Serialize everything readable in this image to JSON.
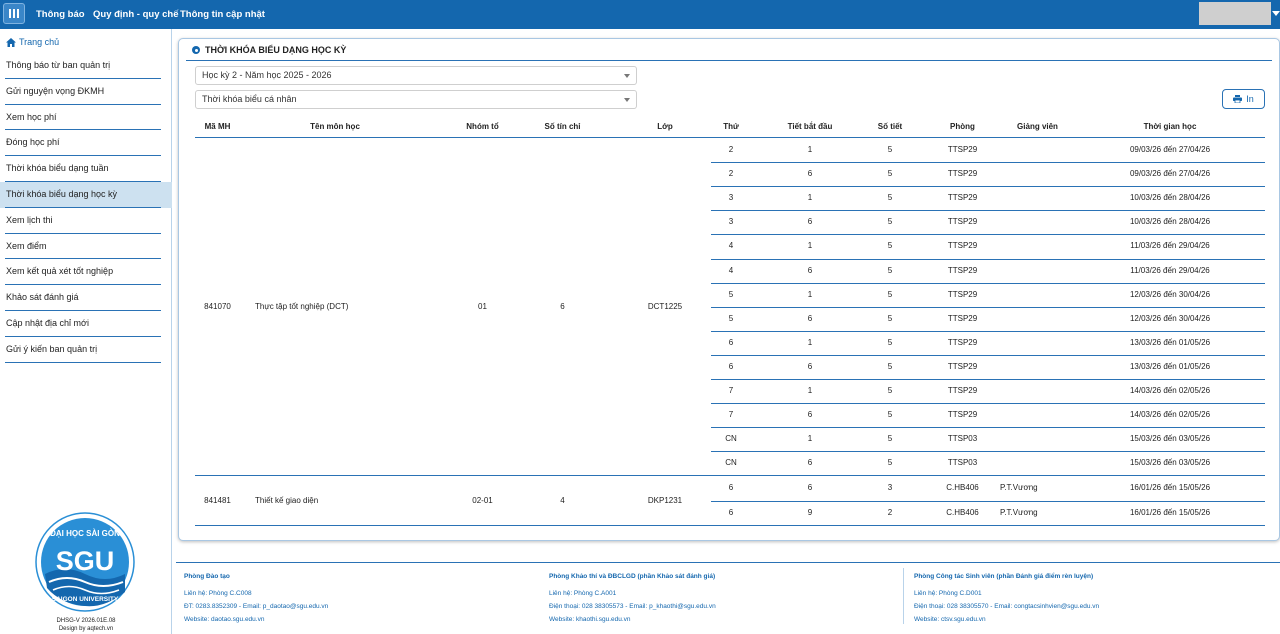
{
  "topbar": {
    "nav": [
      "Thông báo",
      "Quy định - quy chế",
      "Thông tin cập nhật"
    ]
  },
  "sidebar": {
    "home_label": "Trang chủ",
    "items": [
      {
        "label": "Thông báo từ ban quản trị",
        "active": false
      },
      {
        "label": "Gửi nguyện vọng ĐKMH",
        "active": false
      },
      {
        "label": "Xem học phí",
        "active": false
      },
      {
        "label": "Đóng học phí",
        "active": false
      },
      {
        "label": "Thời khóa biểu dạng tuần",
        "active": false
      },
      {
        "label": "Thời khóa biểu dạng học kỳ",
        "active": true
      },
      {
        "label": "Xem lịch thi",
        "active": false
      },
      {
        "label": "Xem điểm",
        "active": false
      },
      {
        "label": "Xem kết quả xét tốt nghiệp",
        "active": false
      },
      {
        "label": "Khảo sát đánh giá",
        "active": false
      },
      {
        "label": "Cập nhật địa chỉ mới",
        "active": false
      },
      {
        "label": "Gửi ý kiến ban quản trị",
        "active": false
      }
    ],
    "logo_text_top": "ĐẠI HỌC SÀI GÒN",
    "logo_text_mid": "SGU",
    "logo_text_bottom": "SAIGON UNIVERSITY",
    "version": "DHSG-V 2026.01E.08",
    "design_by": "Design by aqtech.vn"
  },
  "main": {
    "title": "THỜI KHÓA BIỂU DẠNG HỌC KỲ",
    "semester_select": "Học kỳ 2 - Năm học 2025 - 2026",
    "type_select": "Thời khóa biểu cá nhân",
    "print_label": "In",
    "columns": [
      "Mã MH",
      "Tên môn học",
      "Nhóm tổ",
      "Số tín chỉ",
      "Lớp",
      "Thứ",
      "Tiết bắt đầu",
      "Số tiết",
      "Phòng",
      "Giảng viên",
      "Thời gian học"
    ],
    "courses": [
      {
        "code": "841070",
        "name": "Thực tập tốt nghiệp (DCT)",
        "group": "01",
        "credits": "6",
        "class": "DCT1225",
        "sessions": [
          {
            "day": "2",
            "start": "1",
            "periods": "5",
            "room": "TTSP29",
            "lecturer": "",
            "time": "09/03/26 đến 27/04/26"
          },
          {
            "day": "2",
            "start": "6",
            "periods": "5",
            "room": "TTSP29",
            "lecturer": "",
            "time": "09/03/26 đến 27/04/26"
          },
          {
            "day": "3",
            "start": "1",
            "periods": "5",
            "room": "TTSP29",
            "lecturer": "",
            "time": "10/03/26 đến 28/04/26"
          },
          {
            "day": "3",
            "start": "6",
            "periods": "5",
            "room": "TTSP29",
            "lecturer": "",
            "time": "10/03/26 đến 28/04/26"
          },
          {
            "day": "4",
            "start": "1",
            "periods": "5",
            "room": "TTSP29",
            "lecturer": "",
            "time": "11/03/26 đến 29/04/26"
          },
          {
            "day": "4",
            "start": "6",
            "periods": "5",
            "room": "TTSP29",
            "lecturer": "",
            "time": "11/03/26 đến 29/04/26"
          },
          {
            "day": "5",
            "start": "1",
            "periods": "5",
            "room": "TTSP29",
            "lecturer": "",
            "time": "12/03/26 đến 30/04/26"
          },
          {
            "day": "5",
            "start": "6",
            "periods": "5",
            "room": "TTSP29",
            "lecturer": "",
            "time": "12/03/26 đến 30/04/26"
          },
          {
            "day": "6",
            "start": "1",
            "periods": "5",
            "room": "TTSP29",
            "lecturer": "",
            "time": "13/03/26 đến 01/05/26"
          },
          {
            "day": "6",
            "start": "6",
            "periods": "5",
            "room": "TTSP29",
            "lecturer": "",
            "time": "13/03/26 đến 01/05/26"
          },
          {
            "day": "7",
            "start": "1",
            "periods": "5",
            "room": "TTSP29",
            "lecturer": "",
            "time": "14/03/26 đến 02/05/26"
          },
          {
            "day": "7",
            "start": "6",
            "periods": "5",
            "room": "TTSP29",
            "lecturer": "",
            "time": "14/03/26 đến 02/05/26"
          },
          {
            "day": "CN",
            "start": "1",
            "periods": "5",
            "room": "TTSP03",
            "lecturer": "",
            "time": "15/03/26 đến 03/05/26"
          },
          {
            "day": "CN",
            "start": "6",
            "periods": "5",
            "room": "TTSP03",
            "lecturer": "",
            "time": "15/03/26 đến 03/05/26"
          }
        ]
      },
      {
        "code": "841481",
        "name": "Thiết kế giao diện",
        "group": "02-01",
        "credits": "4",
        "class": "DKP1231",
        "sessions": [
          {
            "day": "6",
            "start": "6",
            "periods": "3",
            "room": "C.HB406",
            "lecturer": "P.T.Vương",
            "time": "16/01/26 đến 15/05/26"
          },
          {
            "day": "6",
            "start": "9",
            "periods": "2",
            "room": "C.HB406",
            "lecturer": "P.T.Vương",
            "time": "16/01/26 đến 15/05/26"
          }
        ]
      }
    ]
  },
  "footer": [
    {
      "title": "Phòng Đào tạo",
      "contact": "Liên hệ: Phòng C.C008",
      "phone": "ĐT: 0283.8352309 - Email: p_daotao@sgu.edu.vn",
      "website": "Website: daotao.sgu.edu.vn"
    },
    {
      "title": "Phòng Khảo thí và ĐBCLGD (phần Khảo sát đánh giá)",
      "contact": "Liên hệ: Phòng C.A001",
      "phone": "Điện thoại: 028 38305573 - Email: p_khaothi@sgu.edu.vn",
      "website": "Website: khaothi.sgu.edu.vn"
    },
    {
      "title": "Phòng Công tác Sinh viên (phần Đánh giá điểm rèn luyện)",
      "contact": "Liên hệ: Phòng C.D001",
      "phone": "Điện thoại: 028 38305570 - Email: congtacsinhvien@sgu.edu.vn",
      "website": "Website: ctsv.sgu.edu.vn"
    }
  ],
  "colors": {
    "primary": "#1467ae",
    "active_bg": "#cde1f0",
    "rule": "#2a72b5"
  }
}
